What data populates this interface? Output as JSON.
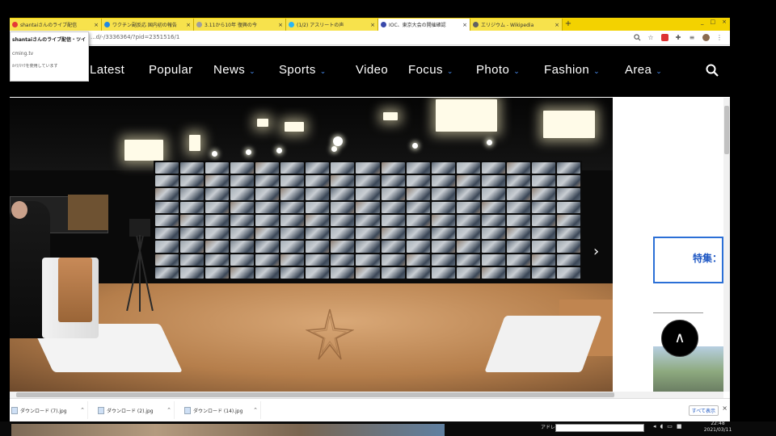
{
  "browser": {
    "tabs": [
      {
        "label": "shantaiさんのライブ配信",
        "color": "#e53935",
        "active": false
      },
      {
        "label": "ワクチン副反応 国内初の報告",
        "color": "#1e88e5",
        "active": false
      },
      {
        "label": "3.11から10年 復興の今",
        "color": "#9e9e9e",
        "active": false
      },
      {
        "label": "(1/2) アスリートの声",
        "color": "#29b6f6",
        "active": false
      },
      {
        "label": "IOC、東京大会の開催確認",
        "color": "#3949ab",
        "active": true
      },
      {
        "label": "エリジウム - Wikipedia",
        "color": "#616161",
        "active": false
      }
    ],
    "new_tab": "+",
    "window_controls": [
      "_",
      "□",
      "×"
    ],
    "url": "...d/-/3336364/?pid=2351516/1",
    "toolbar_icons": [
      "zoom-icon",
      "star-icon",
      "extension-icon",
      "puzzle-icon",
      "menu-icon",
      "avatar-icon",
      "kebab-icon"
    ]
  },
  "popup": {
    "title": "shantaiさんのライブ配信・ツイ",
    "site": "cming.tv",
    "note": "ｶﾒﾗ/ﾏｲｸを使用しています"
  },
  "site_nav": {
    "items": [
      {
        "label": "S Latest",
        "dropdown": false
      },
      {
        "label": "Popular",
        "dropdown": false
      },
      {
        "label": "News",
        "dropdown": true
      },
      {
        "label": "Sports",
        "dropdown": true
      },
      {
        "label": "Video",
        "dropdown": false
      },
      {
        "label": "Focus",
        "dropdown": true
      },
      {
        "label": "Photo",
        "dropdown": true
      },
      {
        "label": "Fashion",
        "dropdown": true
      },
      {
        "label": "Area",
        "dropdown": true
      }
    ],
    "chevron": "⌄",
    "search_icon": "search-icon"
  },
  "video": {
    "next_arrow": "›"
  },
  "sidebar": {
    "special_label": "特集：",
    "up_button": "∧"
  },
  "downloads": {
    "items": [
      "ダウンロード (7).jpg",
      "ダウンロード (2).jpg",
      "ダウンロード (14).jpg"
    ],
    "chevron": "⌃",
    "show_all": "すべて表示",
    "close": "×"
  },
  "taskbar": {
    "address_label": "アドレス",
    "time": "22:48",
    "date": "2021/03/11"
  },
  "colors": {
    "tabstrip": "#f3d200",
    "nav_bg": "#000000",
    "accent_blue": "#2b6fd6"
  }
}
